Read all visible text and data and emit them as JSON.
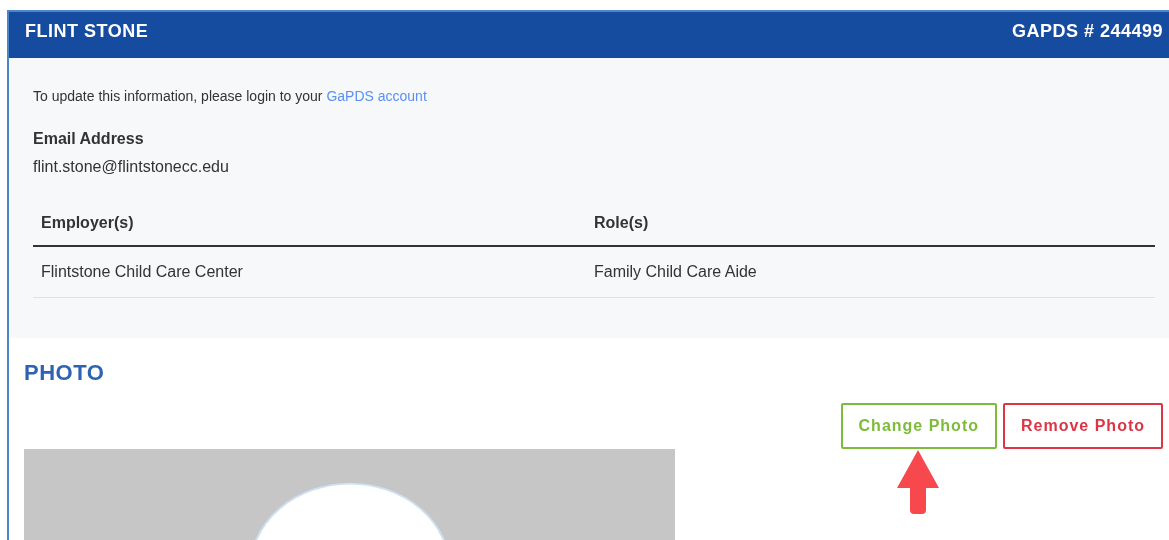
{
  "header": {
    "name": "FLINT STONE",
    "id_label": "GAPDS # 244499"
  },
  "info": {
    "notice": "To update this information, please login to your ",
    "link": "GaPDS account",
    "email_label": "Email Address",
    "email": "flint.stone@flintstonecc.edu"
  },
  "table": {
    "columns": [
      "Employer(s)",
      "Role(s)"
    ],
    "rows": [
      [
        "Flintstone Child Care Center",
        "Family Child Care Aide"
      ]
    ]
  },
  "photo": {
    "title": "PHOTO",
    "buttons": [
      {
        "label": "Change Photo",
        "kind": "change"
      },
      {
        "label": "Remove Photo",
        "kind": "remove"
      }
    ]
  }
}
